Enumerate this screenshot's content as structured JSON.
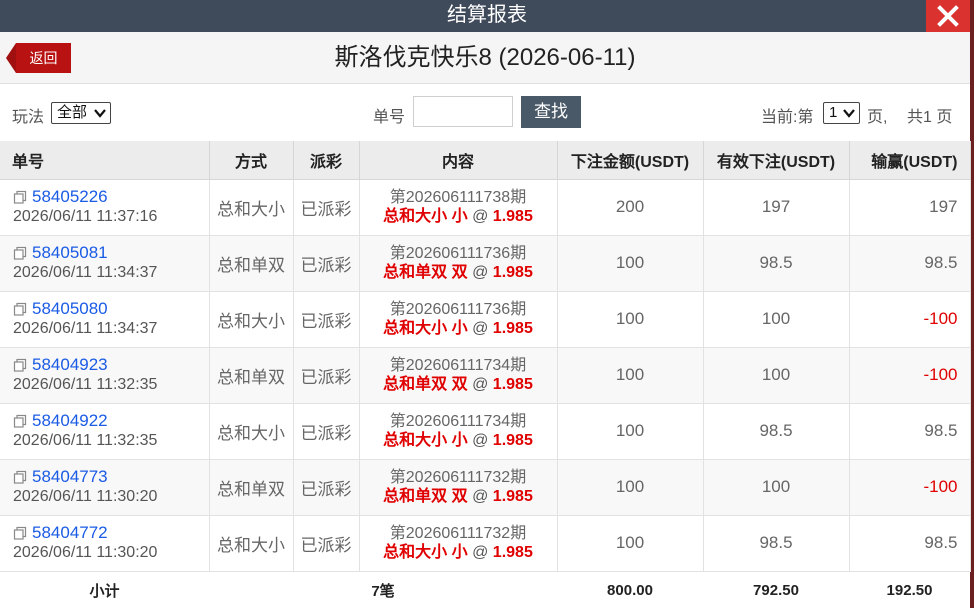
{
  "window": {
    "title": "结算报表"
  },
  "header": {
    "back_label": "返回",
    "page_title": "斯洛伐克快乐8 (2026-06-11)"
  },
  "toolbar": {
    "play_label": "玩法",
    "play_selected": "全部",
    "order_label": "单号",
    "order_value": "",
    "search_label": "查找",
    "current_prefix": "当前:第",
    "current_page": "1",
    "page_suffix": "页,",
    "total_pages": "共1 页"
  },
  "table": {
    "columns": [
      "单号",
      "方式",
      "派彩",
      "内容",
      "下注金额(USDT)",
      "有效下注(USDT)",
      "输赢(USDT)"
    ],
    "rows": [
      {
        "order_no": "58405226",
        "time": "2026/06/11 11:37:16",
        "method": "总和大小",
        "status": "已派彩",
        "period": "第202606111738期",
        "bet_type": "总和大小",
        "pick": "小",
        "at": "@",
        "odds": "1.985",
        "amount": "200",
        "valid": "197",
        "result": "197"
      },
      {
        "order_no": "58405081",
        "time": "2026/06/11 11:34:37",
        "method": "总和单双",
        "status": "已派彩",
        "period": "第202606111736期",
        "bet_type": "总和单双",
        "pick": "双",
        "at": "@",
        "odds": "1.985",
        "amount": "100",
        "valid": "98.5",
        "result": "98.5"
      },
      {
        "order_no": "58405080",
        "time": "2026/06/11 11:34:37",
        "method": "总和大小",
        "status": "已派彩",
        "period": "第202606111736期",
        "bet_type": "总和大小",
        "pick": "小",
        "at": "@",
        "odds": "1.985",
        "amount": "100",
        "valid": "100",
        "result": "-100"
      },
      {
        "order_no": "58404923",
        "time": "2026/06/11 11:32:35",
        "method": "总和单双",
        "status": "已派彩",
        "period": "第202606111734期",
        "bet_type": "总和单双",
        "pick": "双",
        "at": "@",
        "odds": "1.985",
        "amount": "100",
        "valid": "100",
        "result": "-100"
      },
      {
        "order_no": "58404922",
        "time": "2026/06/11 11:32:35",
        "method": "总和大小",
        "status": "已派彩",
        "period": "第202606111734期",
        "bet_type": "总和大小",
        "pick": "小",
        "at": "@",
        "odds": "1.985",
        "amount": "100",
        "valid": "98.5",
        "result": "98.5"
      },
      {
        "order_no": "58404773",
        "time": "2026/06/11 11:30:20",
        "method": "总和单双",
        "status": "已派彩",
        "period": "第202606111732期",
        "bet_type": "总和单双",
        "pick": "双",
        "at": "@",
        "odds": "1.985",
        "amount": "100",
        "valid": "100",
        "result": "-100"
      },
      {
        "order_no": "58404772",
        "time": "2026/06/11 11:30:20",
        "method": "总和大小",
        "status": "已派彩",
        "period": "第202606111732期",
        "bet_type": "总和大小",
        "pick": "小",
        "at": "@",
        "odds": "1.985",
        "amount": "100",
        "valid": "98.5",
        "result": "98.5"
      }
    ],
    "subtotal": {
      "label": "小计",
      "count": "7笔",
      "amount": "800.00",
      "valid": "792.50",
      "result": "192.50"
    }
  },
  "colors": {
    "titlebar": "#3f4a5a",
    "close": "#d9322f",
    "back": "#b81212",
    "link": "#1a5be6",
    "loss": "#e00000"
  },
  "icons": {
    "close": "close-icon",
    "back": "back-arrow-icon",
    "copy": "copy-icon",
    "select": "chevron-down-icon"
  }
}
